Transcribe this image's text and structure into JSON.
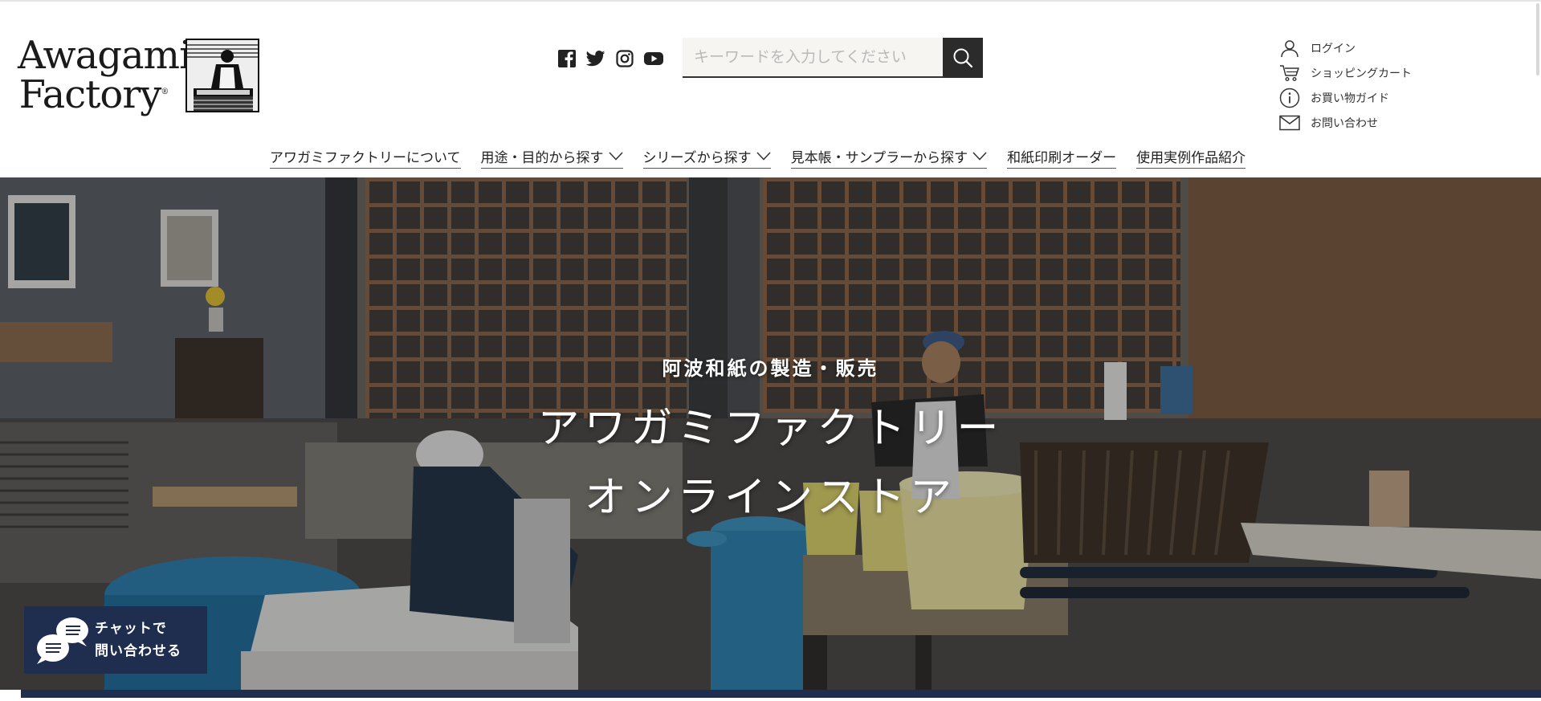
{
  "brand": {
    "logo_line1": "Awagami",
    "logo_line2": "Factory",
    "registered": "®"
  },
  "social": [
    {
      "name": "facebook-icon"
    },
    {
      "name": "twitter-icon"
    },
    {
      "name": "instagram-icon"
    },
    {
      "name": "youtube-icon"
    }
  ],
  "search": {
    "placeholder": "キーワードを入力してください",
    "value": ""
  },
  "utility_links": {
    "login": "ログイン",
    "cart": "ショッピングカート",
    "guide": "お買い物ガイド",
    "contact": "お問い合わせ"
  },
  "nav": {
    "about": "アワガミファクトリーについて",
    "by_use": "用途・目的から探す",
    "by_series": "シリーズから探す",
    "samples": "見本帳・サンプラーから探す",
    "print_order": "和紙印刷オーダー",
    "gallery": "使用実例作品紹介"
  },
  "hero": {
    "subtitle": "阿波和紙の製造・販売",
    "title_line1": "アワガミファクトリー",
    "title_line2": "オンラインストア"
  },
  "chat": {
    "line1": "チャットで",
    "line2": "問い合わせる"
  },
  "colors": {
    "navy": "#1f2d4e",
    "search_button": "#2b2b2b",
    "search_field": "#f6f5f2"
  }
}
